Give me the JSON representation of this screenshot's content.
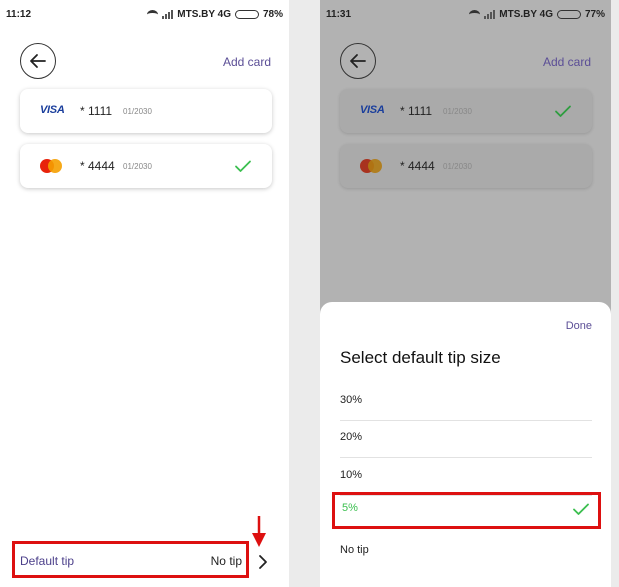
{
  "left": {
    "status_bar": {
      "time": "11:12",
      "carrier": "MTS.BY 4G",
      "battery": "78%",
      "battery_level": 0.78
    },
    "header": {
      "add_card_label": "Add card"
    },
    "cards": [
      {
        "brand": "VISA",
        "brand_icon": "visa-logo",
        "number": "* 1111",
        "expiry": "01/2030",
        "selected": false
      },
      {
        "brand": "Mastercard",
        "brand_icon": "mastercard-logo",
        "number": "* 4444",
        "expiry": "01/2030",
        "selected": true
      }
    ],
    "tip_row": {
      "label": "Default tip",
      "value": "No tip"
    }
  },
  "right": {
    "status_bar": {
      "time": "11:31",
      "carrier": "MTS.BY 4G",
      "battery": "77%",
      "battery_level": 0.77
    },
    "header": {
      "add_card_label": "Add card"
    },
    "cards": [
      {
        "brand": "VISA",
        "brand_icon": "visa-logo",
        "number": "* 1111",
        "expiry": "01/2030",
        "selected": true
      },
      {
        "brand": "Mastercard",
        "brand_icon": "mastercard-logo",
        "number": "* 4444",
        "expiry": "01/2030",
        "selected": false
      }
    ],
    "sheet": {
      "done_label": "Done",
      "title": "Select default tip size",
      "options": [
        {
          "label": "30%",
          "selected": false
        },
        {
          "label": "20%",
          "selected": false
        },
        {
          "label": "10%",
          "selected": false
        },
        {
          "label": "5%",
          "selected": true
        },
        {
          "label": "No tip",
          "selected": false
        }
      ]
    }
  },
  "colors": {
    "accent": "#5b4e96",
    "check": "#3bbf4f",
    "highlight": "#dd1010",
    "battery": "#f2b300",
    "overlay": "#b2b2b2"
  }
}
